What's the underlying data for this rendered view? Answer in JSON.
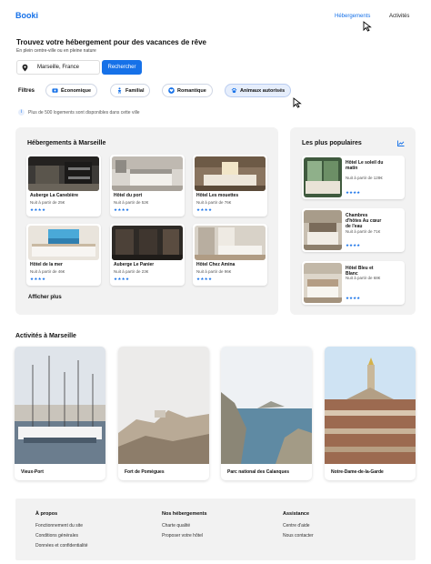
{
  "header": {
    "logo": "Booki",
    "nav": [
      "Hébergements",
      "Activités"
    ]
  },
  "hero": {
    "title": "Trouvez votre hébergement pour des vacances de rêve",
    "subtitle": "En plein centre-ville ou en pleine nature",
    "search_value": "Marseille, France",
    "search_button": "Rechercher"
  },
  "filters": {
    "label": "Filtres",
    "items": [
      {
        "label": "Économique",
        "icon": "money-icon"
      },
      {
        "label": "Familial",
        "icon": "person-icon"
      },
      {
        "label": "Romantique",
        "icon": "heart-icon"
      },
      {
        "label": "Animaux autorisés",
        "icon": "paw-icon"
      }
    ],
    "selected": "Animaux autorisés"
  },
  "info": {
    "icon": "info-icon",
    "text": "Plus de 500 logements sont disponibles dans cette ville"
  },
  "lodging": {
    "title": "Hébergements à Marseille",
    "cards": [
      {
        "name": "Auberge La Canebière",
        "price": "Nuit à partir de 25€",
        "rating": 4
      },
      {
        "name": "Hôtel du port",
        "price": "Nuit à partir de 52€",
        "rating": 4
      },
      {
        "name": "Hôtel Les mouettes",
        "price": "Nuit à partir de 76€",
        "rating": 4
      },
      {
        "name": "Hôtel de la mer",
        "price": "Nuit à partir de 46€",
        "rating": 4
      },
      {
        "name": "Auberge Le Panier",
        "price": "Nuit à partir de 23€",
        "rating": 4
      },
      {
        "name": "Hôtel Chez Amina",
        "price": "Nuit à partir de 96€",
        "rating": 4
      }
    ],
    "show_more": "Afficher plus"
  },
  "popular": {
    "title": "Les plus populaires",
    "icon": "trend-icon",
    "cards": [
      {
        "name": "Hôtel Le soleil du matin",
        "price": "Nuit à partir de 128€",
        "rating": 4
      },
      {
        "name": "Chambres d'hôtes Au cœur de l'eau",
        "price": "Nuit à partir de 71€",
        "rating": 4
      },
      {
        "name": "Hôtel Bleu et Blanc",
        "price": "Nuit à partir de 68€",
        "rating": 4
      }
    ]
  },
  "activities": {
    "title": "Activités à Marseille",
    "cards": [
      {
        "label": "Vieux-Port"
      },
      {
        "label": "Fort de Pomègues"
      },
      {
        "label": "Parc national des Calanques"
      },
      {
        "label": "Notre-Dame-de-la-Garde"
      }
    ]
  },
  "footer": {
    "columns": [
      {
        "title": "À propos",
        "links": [
          "Fonctionnement du site",
          "Conditions générales",
          "Données et confidentialité"
        ]
      },
      {
        "title": "Nos hébergements",
        "links": [
          "Charte qualité",
          "Proposer votre hôtel"
        ]
      },
      {
        "title": "Assistance",
        "links": [
          "Centre d'aide",
          "Nous contacter"
        ]
      }
    ]
  },
  "colors": {
    "accent": "#1671e8",
    "panel": "#f2f2f2",
    "chip_selected": "#e6eefc"
  }
}
